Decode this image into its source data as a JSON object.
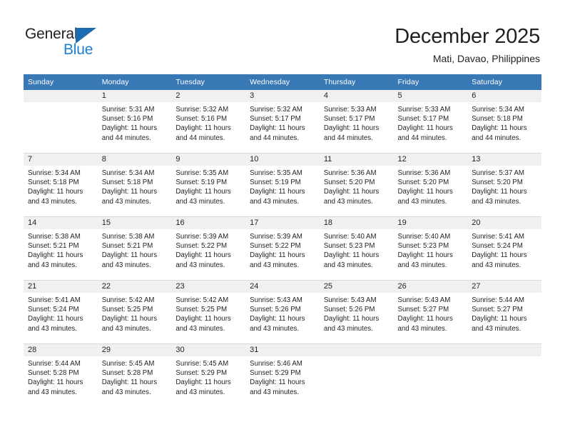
{
  "logo": {
    "word_top": "General",
    "word_bottom": "Blue",
    "triangle_icon": "triangle-icon",
    "accent_dark": "#1b6cb0",
    "accent_light": "#1b7fd4"
  },
  "header": {
    "title": "December 2025",
    "subtitle": "Mati, Davao, Philippines"
  },
  "theme": {
    "header_bg": "#3878b4",
    "header_text": "#ffffff",
    "daynum_bg": "#f0f0f0",
    "cell_bg": "#ffffff",
    "grid_line": "#d9d9d9",
    "text": "#231f20"
  },
  "calendar": {
    "weekday_headers": [
      "Sunday",
      "Monday",
      "Tuesday",
      "Wednesday",
      "Thursday",
      "Friday",
      "Saturday"
    ],
    "weeks": [
      [
        {
          "day": "",
          "empty": true
        },
        {
          "day": "1",
          "sunrise": "Sunrise: 5:31 AM",
          "sunset": "Sunset: 5:16 PM",
          "daylight_line1": "Daylight: 11 hours",
          "daylight_line2": "and 44 minutes."
        },
        {
          "day": "2",
          "sunrise": "Sunrise: 5:32 AM",
          "sunset": "Sunset: 5:16 PM",
          "daylight_line1": "Daylight: 11 hours",
          "daylight_line2": "and 44 minutes."
        },
        {
          "day": "3",
          "sunrise": "Sunrise: 5:32 AM",
          "sunset": "Sunset: 5:17 PM",
          "daylight_line1": "Daylight: 11 hours",
          "daylight_line2": "and 44 minutes."
        },
        {
          "day": "4",
          "sunrise": "Sunrise: 5:33 AM",
          "sunset": "Sunset: 5:17 PM",
          "daylight_line1": "Daylight: 11 hours",
          "daylight_line2": "and 44 minutes."
        },
        {
          "day": "5",
          "sunrise": "Sunrise: 5:33 AM",
          "sunset": "Sunset: 5:17 PM",
          "daylight_line1": "Daylight: 11 hours",
          "daylight_line2": "and 44 minutes."
        },
        {
          "day": "6",
          "sunrise": "Sunrise: 5:34 AM",
          "sunset": "Sunset: 5:18 PM",
          "daylight_line1": "Daylight: 11 hours",
          "daylight_line2": "and 44 minutes."
        }
      ],
      [
        {
          "day": "7",
          "sunrise": "Sunrise: 5:34 AM",
          "sunset": "Sunset: 5:18 PM",
          "daylight_line1": "Daylight: 11 hours",
          "daylight_line2": "and 43 minutes."
        },
        {
          "day": "8",
          "sunrise": "Sunrise: 5:34 AM",
          "sunset": "Sunset: 5:18 PM",
          "daylight_line1": "Daylight: 11 hours",
          "daylight_line2": "and 43 minutes."
        },
        {
          "day": "9",
          "sunrise": "Sunrise: 5:35 AM",
          "sunset": "Sunset: 5:19 PM",
          "daylight_line1": "Daylight: 11 hours",
          "daylight_line2": "and 43 minutes."
        },
        {
          "day": "10",
          "sunrise": "Sunrise: 5:35 AM",
          "sunset": "Sunset: 5:19 PM",
          "daylight_line1": "Daylight: 11 hours",
          "daylight_line2": "and 43 minutes."
        },
        {
          "day": "11",
          "sunrise": "Sunrise: 5:36 AM",
          "sunset": "Sunset: 5:20 PM",
          "daylight_line1": "Daylight: 11 hours",
          "daylight_line2": "and 43 minutes."
        },
        {
          "day": "12",
          "sunrise": "Sunrise: 5:36 AM",
          "sunset": "Sunset: 5:20 PM",
          "daylight_line1": "Daylight: 11 hours",
          "daylight_line2": "and 43 minutes."
        },
        {
          "day": "13",
          "sunrise": "Sunrise: 5:37 AM",
          "sunset": "Sunset: 5:20 PM",
          "daylight_line1": "Daylight: 11 hours",
          "daylight_line2": "and 43 minutes."
        }
      ],
      [
        {
          "day": "14",
          "sunrise": "Sunrise: 5:38 AM",
          "sunset": "Sunset: 5:21 PM",
          "daylight_line1": "Daylight: 11 hours",
          "daylight_line2": "and 43 minutes."
        },
        {
          "day": "15",
          "sunrise": "Sunrise: 5:38 AM",
          "sunset": "Sunset: 5:21 PM",
          "daylight_line1": "Daylight: 11 hours",
          "daylight_line2": "and 43 minutes."
        },
        {
          "day": "16",
          "sunrise": "Sunrise: 5:39 AM",
          "sunset": "Sunset: 5:22 PM",
          "daylight_line1": "Daylight: 11 hours",
          "daylight_line2": "and 43 minutes."
        },
        {
          "day": "17",
          "sunrise": "Sunrise: 5:39 AM",
          "sunset": "Sunset: 5:22 PM",
          "daylight_line1": "Daylight: 11 hours",
          "daylight_line2": "and 43 minutes."
        },
        {
          "day": "18",
          "sunrise": "Sunrise: 5:40 AM",
          "sunset": "Sunset: 5:23 PM",
          "daylight_line1": "Daylight: 11 hours",
          "daylight_line2": "and 43 minutes."
        },
        {
          "day": "19",
          "sunrise": "Sunrise: 5:40 AM",
          "sunset": "Sunset: 5:23 PM",
          "daylight_line1": "Daylight: 11 hours",
          "daylight_line2": "and 43 minutes."
        },
        {
          "day": "20",
          "sunrise": "Sunrise: 5:41 AM",
          "sunset": "Sunset: 5:24 PM",
          "daylight_line1": "Daylight: 11 hours",
          "daylight_line2": "and 43 minutes."
        }
      ],
      [
        {
          "day": "21",
          "sunrise": "Sunrise: 5:41 AM",
          "sunset": "Sunset: 5:24 PM",
          "daylight_line1": "Daylight: 11 hours",
          "daylight_line2": "and 43 minutes."
        },
        {
          "day": "22",
          "sunrise": "Sunrise: 5:42 AM",
          "sunset": "Sunset: 5:25 PM",
          "daylight_line1": "Daylight: 11 hours",
          "daylight_line2": "and 43 minutes."
        },
        {
          "day": "23",
          "sunrise": "Sunrise: 5:42 AM",
          "sunset": "Sunset: 5:25 PM",
          "daylight_line1": "Daylight: 11 hours",
          "daylight_line2": "and 43 minutes."
        },
        {
          "day": "24",
          "sunrise": "Sunrise: 5:43 AM",
          "sunset": "Sunset: 5:26 PM",
          "daylight_line1": "Daylight: 11 hours",
          "daylight_line2": "and 43 minutes."
        },
        {
          "day": "25",
          "sunrise": "Sunrise: 5:43 AM",
          "sunset": "Sunset: 5:26 PM",
          "daylight_line1": "Daylight: 11 hours",
          "daylight_line2": "and 43 minutes."
        },
        {
          "day": "26",
          "sunrise": "Sunrise: 5:43 AM",
          "sunset": "Sunset: 5:27 PM",
          "daylight_line1": "Daylight: 11 hours",
          "daylight_line2": "and 43 minutes."
        },
        {
          "day": "27",
          "sunrise": "Sunrise: 5:44 AM",
          "sunset": "Sunset: 5:27 PM",
          "daylight_line1": "Daylight: 11 hours",
          "daylight_line2": "and 43 minutes."
        }
      ],
      [
        {
          "day": "28",
          "sunrise": "Sunrise: 5:44 AM",
          "sunset": "Sunset: 5:28 PM",
          "daylight_line1": "Daylight: 11 hours",
          "daylight_line2": "and 43 minutes."
        },
        {
          "day": "29",
          "sunrise": "Sunrise: 5:45 AM",
          "sunset": "Sunset: 5:28 PM",
          "daylight_line1": "Daylight: 11 hours",
          "daylight_line2": "and 43 minutes."
        },
        {
          "day": "30",
          "sunrise": "Sunrise: 5:45 AM",
          "sunset": "Sunset: 5:29 PM",
          "daylight_line1": "Daylight: 11 hours",
          "daylight_line2": "and 43 minutes."
        },
        {
          "day": "31",
          "sunrise": "Sunrise: 5:46 AM",
          "sunset": "Sunset: 5:29 PM",
          "daylight_line1": "Daylight: 11 hours",
          "daylight_line2": "and 43 minutes."
        },
        {
          "day": "",
          "empty": true
        },
        {
          "day": "",
          "empty": true
        },
        {
          "day": "",
          "empty": true
        }
      ]
    ]
  }
}
